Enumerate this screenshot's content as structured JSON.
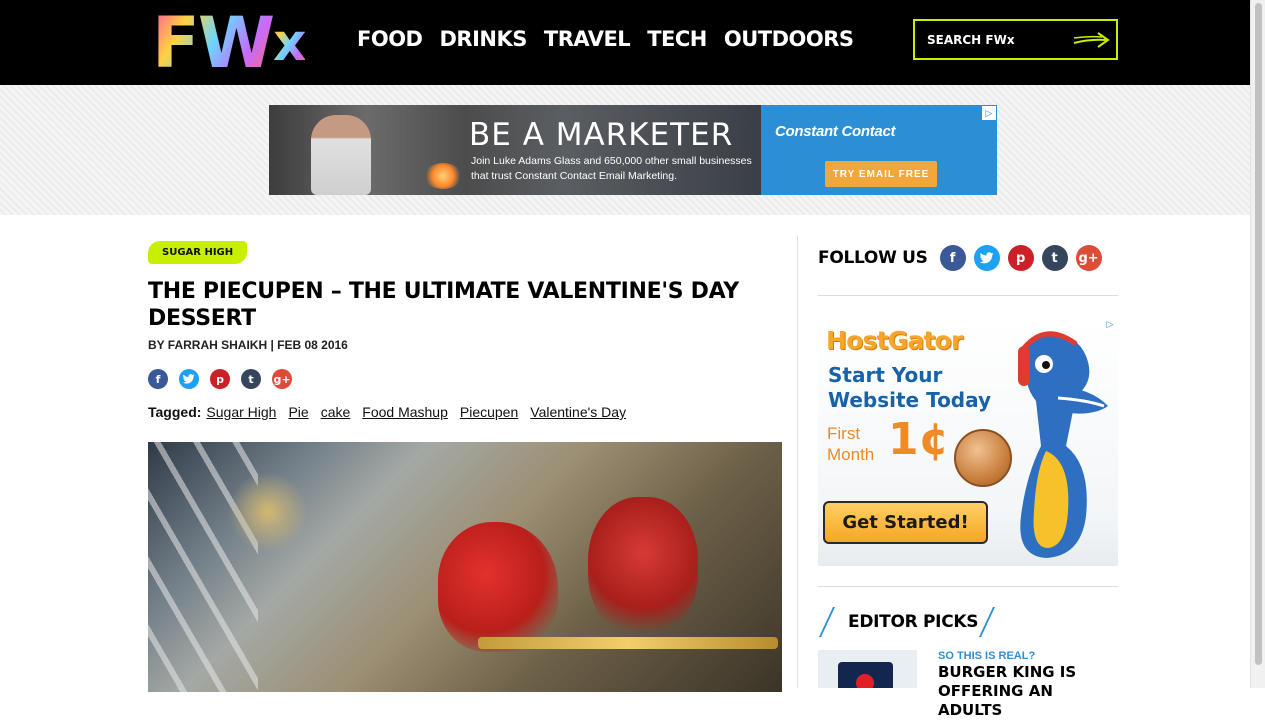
{
  "header": {
    "logo_text": "FW",
    "logo_suffix": "x",
    "nav": [
      "FOOD",
      "DRINKS",
      "TRAVEL",
      "TECH",
      "OUTDOORS"
    ],
    "search_placeholder": "SEARCH FWx"
  },
  "top_ad": {
    "headline": "BE A MARKETER",
    "subtext": "Join Luke Adams Glass and 650,000 other small businesses that trust Constant Contact Email Marketing.",
    "brand": "Constant Contact",
    "cta": "TRY EMAIL FREE",
    "adchoices": "▷"
  },
  "article": {
    "category": "SUGAR HIGH",
    "title": "THE PIECUPEN – THE ULTIMATE VALENTINE'S DAY DESSERT",
    "byline": "BY FARRAH SHAIKH | FEB 08 2016",
    "share_icons": [
      "facebook-icon",
      "twitter-icon",
      "pinterest-icon",
      "tumblr-icon",
      "google-plus-icon"
    ],
    "tagged_label": "Tagged:",
    "tags": [
      "Sugar High",
      "Pie",
      "cake",
      "Food Mashup",
      "Piecupen",
      "Valentine's Day"
    ]
  },
  "sidebar": {
    "follow_label": "FOLLOW US",
    "ad": {
      "logo": "HostGator",
      "headline": "Start Your Website Today",
      "first_month": "First Month",
      "price": "1¢",
      "cta": "Get Started!",
      "adchoices": "▷"
    },
    "editor_picks_title": "EDITOR PICKS",
    "pick": {
      "kicker": "SO THIS IS REAL?",
      "title": "BURGER KING IS OFFERING AN ADULTS"
    }
  },
  "colors": {
    "accent_green": "#c6f000",
    "link_blue": "#2c8fd5",
    "header_bg": "#000000"
  }
}
